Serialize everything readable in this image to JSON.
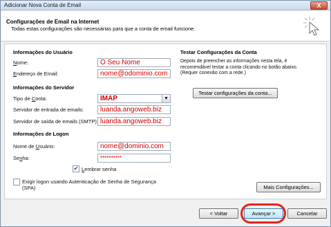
{
  "window": {
    "title": "Adicionar Nova Conta de Email",
    "close_glyph": "X"
  },
  "header": {
    "title": "Configurações de Email na Internet",
    "subtitle": "Todas estas configurações são necessárias para que a conta de email funcione."
  },
  "user_info": {
    "heading": "Informações do Usuário",
    "name_label_key": "N",
    "name_label_rest": "ome:",
    "name_value": "O Seu Nome",
    "email_label_key": "E",
    "email_label_rest": "ndereço de Email:",
    "email_value": "nome@odominio.com"
  },
  "server_info": {
    "heading": "Informações do Servidor",
    "account_type_label_pre": "Tipo de ",
    "account_type_label_key": "C",
    "account_type_label_rest": "onta:",
    "account_type_value": "IMAP",
    "incoming_label": "Servidor de entrada de emails:",
    "incoming_value": "luanda.angoweb.biz",
    "outgoing_label": "Servidor de saída de emails (SMTP):",
    "outgoing_value": "luanda.angoweb.biz"
  },
  "logon_info": {
    "heading": "Informações de Logon",
    "username_label_pre": "Nome de ",
    "username_label_key": "U",
    "username_label_rest": "suário:",
    "username_value": "nome@dominio.com",
    "password_label_pre": "Se",
    "password_label_key": "n",
    "password_label_rest": "ha:",
    "password_value": "**********",
    "remember_label_key": "L",
    "remember_label_rest": "embrar senha",
    "remember_checked": true,
    "spa_label_line1": "Exigir logon usando Autenticação de Senha de Segurança",
    "spa_label_line2": "(SPA)",
    "spa_checked": false
  },
  "test_settings": {
    "heading": "Testar Configurações da Conta",
    "description_line1": "Depois de preencher as informações nesta tela, é",
    "description_line2": "recomendável testar a conta clicando no botão abaixo.",
    "description_line3": "(Requer conexão com a rede.)",
    "test_button_label": "Testar configurações da conta...",
    "more_settings_label": "Mais Configurações..."
  },
  "footer": {
    "back_label": "< Voltar",
    "next_label": "Avançar >",
    "cancel_label": "Cancelar"
  },
  "colors": {
    "field_text": "#d40000",
    "highlight_ring": "#e3241a"
  }
}
